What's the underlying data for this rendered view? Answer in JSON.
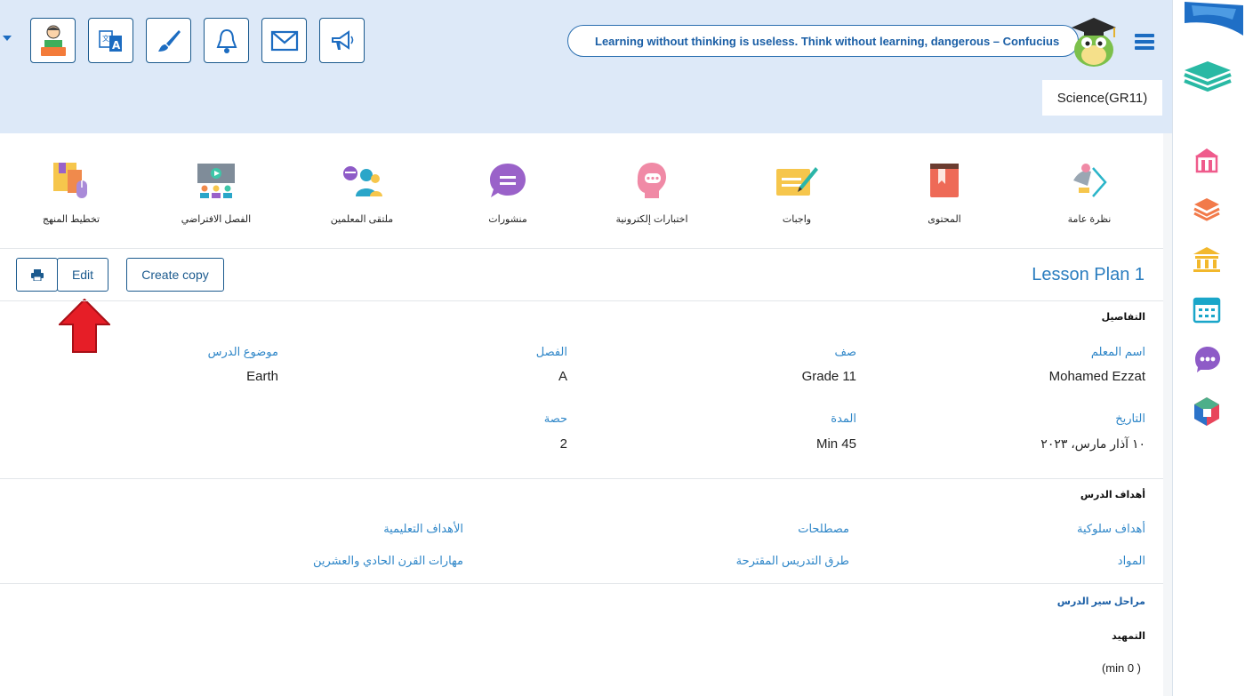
{
  "header": {
    "quote": "Learning without thinking is useless. Think without learning, dangerous – Confucius",
    "subject": "Science(GR11)",
    "tools": [
      "profile-icon",
      "translate-icon",
      "brush-icon",
      "bell-icon",
      "mail-icon",
      "megaphone-icon"
    ]
  },
  "modules": [
    {
      "label": "نظرة عامة",
      "icon": "overview-icon"
    },
    {
      "label": "المحتوى",
      "icon": "book-icon"
    },
    {
      "label": "واجبات",
      "icon": "homework-icon"
    },
    {
      "label": "اختبارات إلكترونية",
      "icon": "quiz-icon"
    },
    {
      "label": "منشورات",
      "icon": "posts-icon"
    },
    {
      "label": "ملتقى المعلمين",
      "icon": "teachers-forum-icon"
    },
    {
      "label": "الفصل الافتراضي",
      "icon": "virtual-class-icon"
    },
    {
      "label": "تخطيط المنهج",
      "icon": "curriculum-planning-icon"
    }
  ],
  "actions": {
    "print": "print-icon",
    "edit": "Edit",
    "copy": "Create copy"
  },
  "lesson_title": "Lesson Plan 1",
  "details": {
    "title": "التفاصيل",
    "teacher_label": "اسم المعلم",
    "teacher_value": "Mohamed Ezzat",
    "grade_label": "صف",
    "grade_value": "Grade 11",
    "class_label": "الفصل",
    "class_value": "A",
    "topic_label": "موضوع الدرس",
    "topic_value": "Earth",
    "date_label": "التاريخ",
    "date_value": "١٠ آذار مارس، ٢٠٢٣",
    "duration_label": "المدة",
    "duration_value": "Min 45",
    "period_label": "حصة",
    "period_value": "2"
  },
  "objectives": {
    "title": "أهداف الدرس",
    "links": [
      "أهداف سلوكية",
      "مصطلحات",
      "الأهداف التعليمية",
      "المواد",
      "طرق التدريس المقترحة",
      "مهارات القرن الحادي والعشرين"
    ]
  },
  "phases": {
    "title": "مراحل سير الدرس",
    "intro_label": "التمهيد",
    "intro_time": "(min 0 )"
  },
  "colors": {
    "accent": "#2e86c8",
    "topbar": "#dde9f8",
    "border": "#1b5a8e"
  }
}
